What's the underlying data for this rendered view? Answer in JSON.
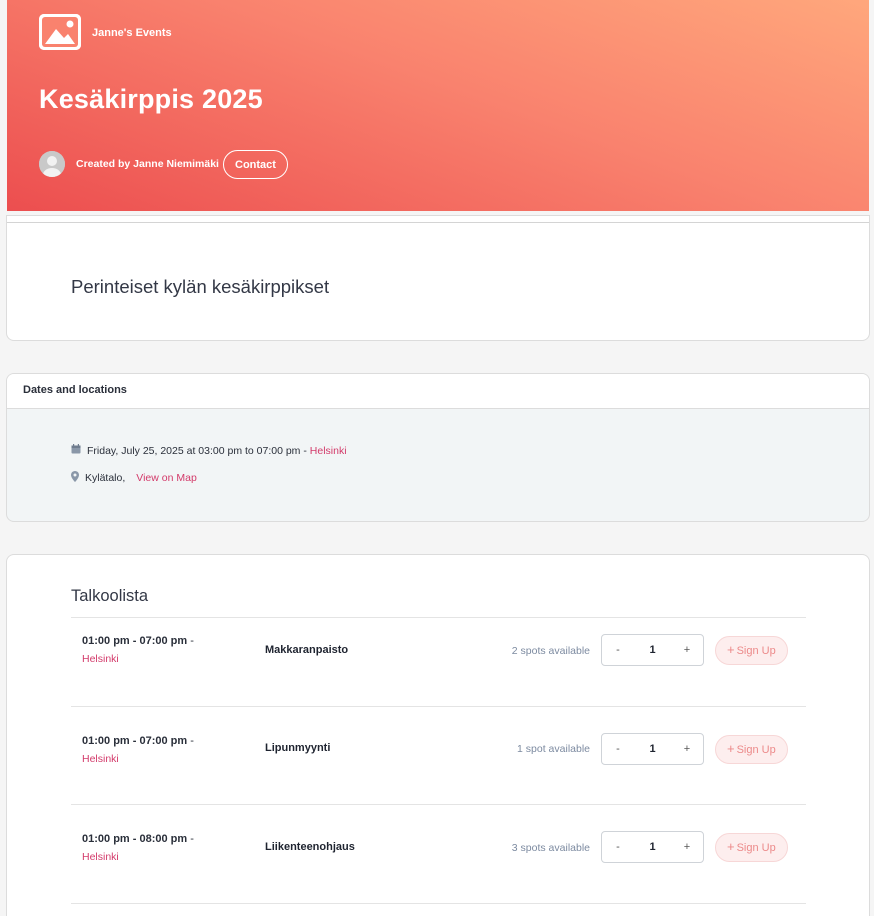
{
  "header": {
    "logo_icon": "image-placeholder-icon",
    "org_name": "Janne's Events",
    "title": "Kesäkirppis 2025",
    "creator": "Created by Janne Niemimäki",
    "contact_label": "Contact"
  },
  "description": {
    "text": "Perinteiset kylän kesäkirppikset"
  },
  "dates": {
    "heading": "Dates and locations",
    "date_text": "Friday, July 25, 2025 at 03:00 pm to 07:00 pm -",
    "date_location": "Helsinki",
    "venue": "Kylätalo,",
    "map_link": "View on Map",
    "colors": {
      "link": "#d33a6a",
      "icon": "#8a97a8"
    }
  },
  "slots": {
    "heading": "Talkoolista",
    "signup_label": "Sign Up",
    "items": [
      {
        "time": "01:00 pm - 07:00 pm",
        "location": "Helsinki",
        "name": "Makkaranpaisto",
        "spots": "2 spots available",
        "qty": "1"
      },
      {
        "time": "01:00 pm - 07:00 pm",
        "location": "Helsinki",
        "name": "Lipunmyynti",
        "spots": "1 spot available",
        "qty": "1"
      },
      {
        "time": "01:00 pm - 08:00 pm",
        "location": "Helsinki",
        "name": "Liikenteenohjaus",
        "spots": "3 spots available",
        "qty": "1"
      }
    ]
  }
}
